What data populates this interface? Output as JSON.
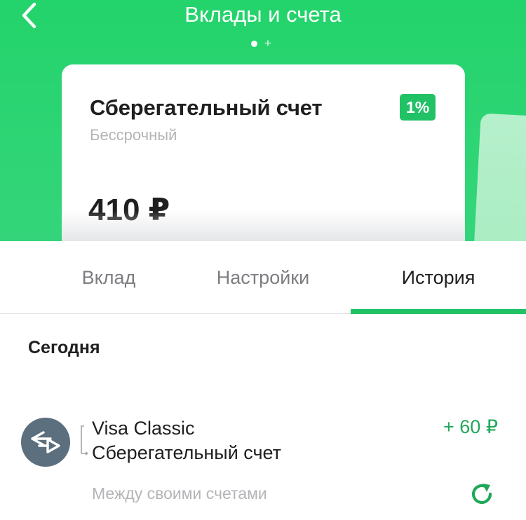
{
  "header": {
    "title": "Вклады и счета",
    "page_plus": "+"
  },
  "card": {
    "title": "Сберегательный счет",
    "subtitle": "Бессрочный",
    "rate": "1%",
    "amount": "410 ₽"
  },
  "tabs": [
    {
      "label": "Вклад"
    },
    {
      "label": "Настройки"
    },
    {
      "label": "История",
      "active": true
    }
  ],
  "history": {
    "section_title": "Сегодня",
    "items": [
      {
        "from": "Visa Classic",
        "to": "Сберегательный счет",
        "amount": "+ 60 ₽",
        "category": "Между своими счетами",
        "icon": "transfer-arrows-icon"
      }
    ]
  },
  "colors": {
    "accent": "#21c265",
    "header_green": "#2ed574",
    "amount_green": "#21a85a",
    "avatar_gray": "#5c6f7e"
  }
}
